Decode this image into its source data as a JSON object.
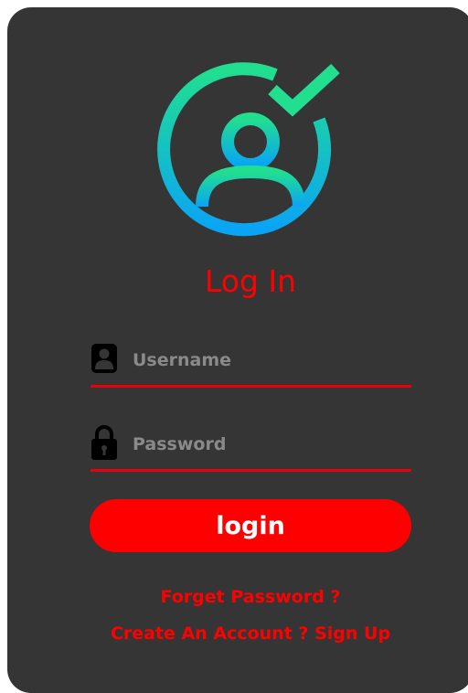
{
  "form": {
    "title": "Log In",
    "username_placeholder": "Username",
    "password_placeholder": "Password",
    "username_value": "",
    "password_value": "",
    "login_label": "login",
    "forgot_label": "Forget Password ?",
    "signup_label": "Create An Account ? Sign Up"
  },
  "icons": {
    "avatar": "user-check-icon",
    "username": "user-icon",
    "password": "lock-icon"
  },
  "colors": {
    "card_background": "#353535",
    "accent": "#ff0000",
    "avatar_gradient_top": "#21df8f",
    "avatar_gradient_bottom": "#0aa4f5",
    "placeholder": "#8a8a8a",
    "button_text": "#ffffff"
  }
}
